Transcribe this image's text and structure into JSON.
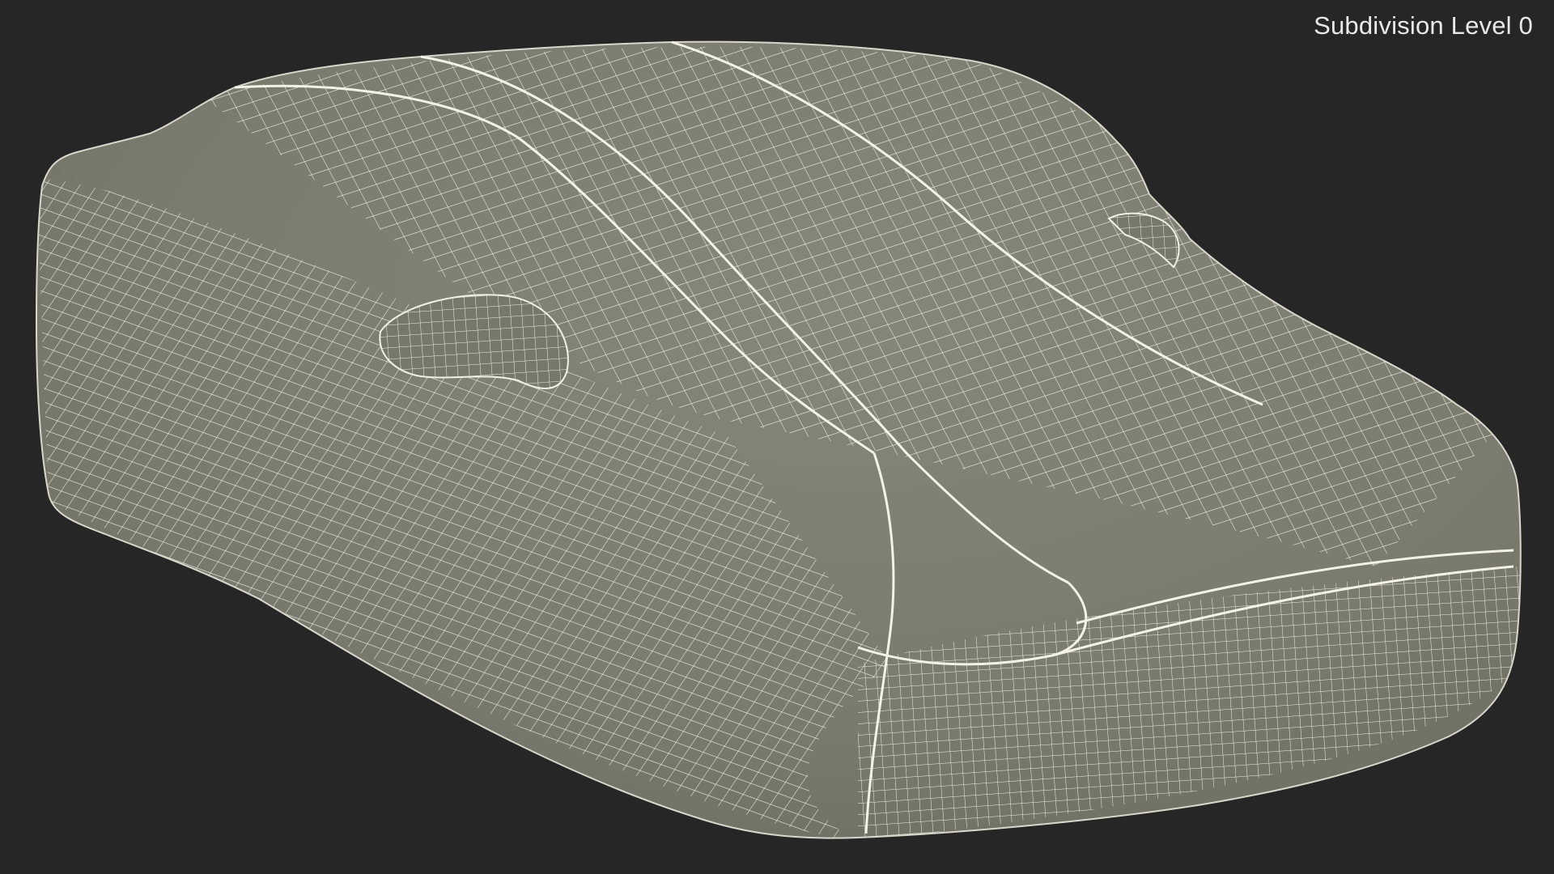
{
  "viewport": {
    "label": "Subdivision Level 0",
    "background_color": "#262626",
    "mesh_fill_color": "#7b7b6e",
    "wire_color": "#f2efe4"
  },
  "model": {
    "subject": "car body cover",
    "display_mode": "wireframe on shaded"
  }
}
